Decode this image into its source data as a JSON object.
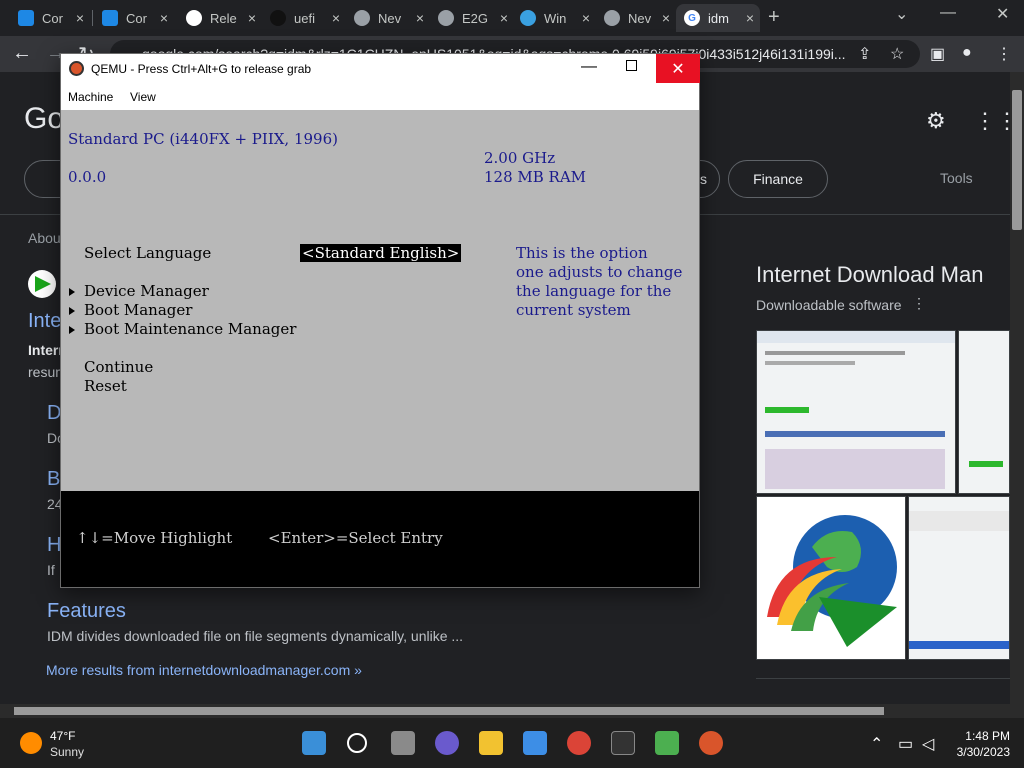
{
  "browser": {
    "tabs": [
      {
        "label": "Cor",
        "icon": "monitor-icon",
        "color": "#1e88e5"
      },
      {
        "label": "Cor",
        "icon": "monitor-icon",
        "color": "#1e88e5"
      },
      {
        "label": "Rele",
        "icon": "github-icon",
        "color": "#ffffff"
      },
      {
        "label": "uefi",
        "icon": "cloud-icon",
        "color": "#222222"
      },
      {
        "label": "Nev",
        "icon": "chrome-icon",
        "color": "#9aa0a6"
      },
      {
        "label": "E2G",
        "icon": "globe-icon",
        "color": "#9aa0a6"
      },
      {
        "label": "Win",
        "icon": "edge-icon",
        "color": "#3aa0e0"
      },
      {
        "label": "Nev",
        "icon": "chrome-icon",
        "color": "#9aa0a6"
      },
      {
        "label": "idm",
        "icon": "google-icon",
        "color": "#ffffff",
        "active": true
      }
    ],
    "url": "google.com/search?q=idm&rlz=1C1CHZN_enUS1051&oq=id&aqs=chrome.0.69i59i69i57j0i433i512j46i131i199i..."
  },
  "google": {
    "logo": "Go",
    "chips": [
      {
        "label": "s"
      },
      {
        "label": "Finance"
      }
    ],
    "tools": "Tools",
    "about": "Abou",
    "left": {
      "result_title": "Inte",
      "result_line1": "Intern",
      "result_line2": "resum",
      "link1": "D",
      "link1_sub": "Do",
      "link2": "B",
      "link2_sub": "24",
      "link3": "H",
      "link3_sub": "If",
      "features_title": "Features",
      "features_desc": "IDM divides downloaded file on file segments dynamically, unlike ...",
      "more_results": "More results from internetdownloadmanager.com »"
    },
    "knowledge_panel": {
      "title": "Internet Download Man",
      "subtitle": "Downloadable software",
      "more": "⋮"
    }
  },
  "qemu": {
    "title": "QEMU - Press Ctrl+Alt+G to release grab",
    "menu": [
      "Machine",
      "View"
    ],
    "bios": {
      "platform": "Standard PC (i440FX + PIIX, 1996)",
      "version": "0.0.0",
      "cpu": "2.00 GHz",
      "ram": "128 MB RAM",
      "select_language_label": "Select Language",
      "select_language_value": "<Standard English>",
      "help_text": [
        "This is the option",
        "one adjusts to change",
        "the language for the",
        "current system"
      ],
      "menu_items": [
        "Device Manager",
        "Boot Manager",
        "Boot Maintenance Manager"
      ],
      "actions": [
        "Continue",
        "Reset"
      ],
      "hint_move": "↑↓=Move Highlight",
      "hint_select": "<Enter>=Select Entry"
    }
  },
  "taskbar": {
    "weather_temp": "47°F",
    "weather_cond": "Sunny",
    "time": "1:48 PM",
    "date": "3/30/2023"
  }
}
